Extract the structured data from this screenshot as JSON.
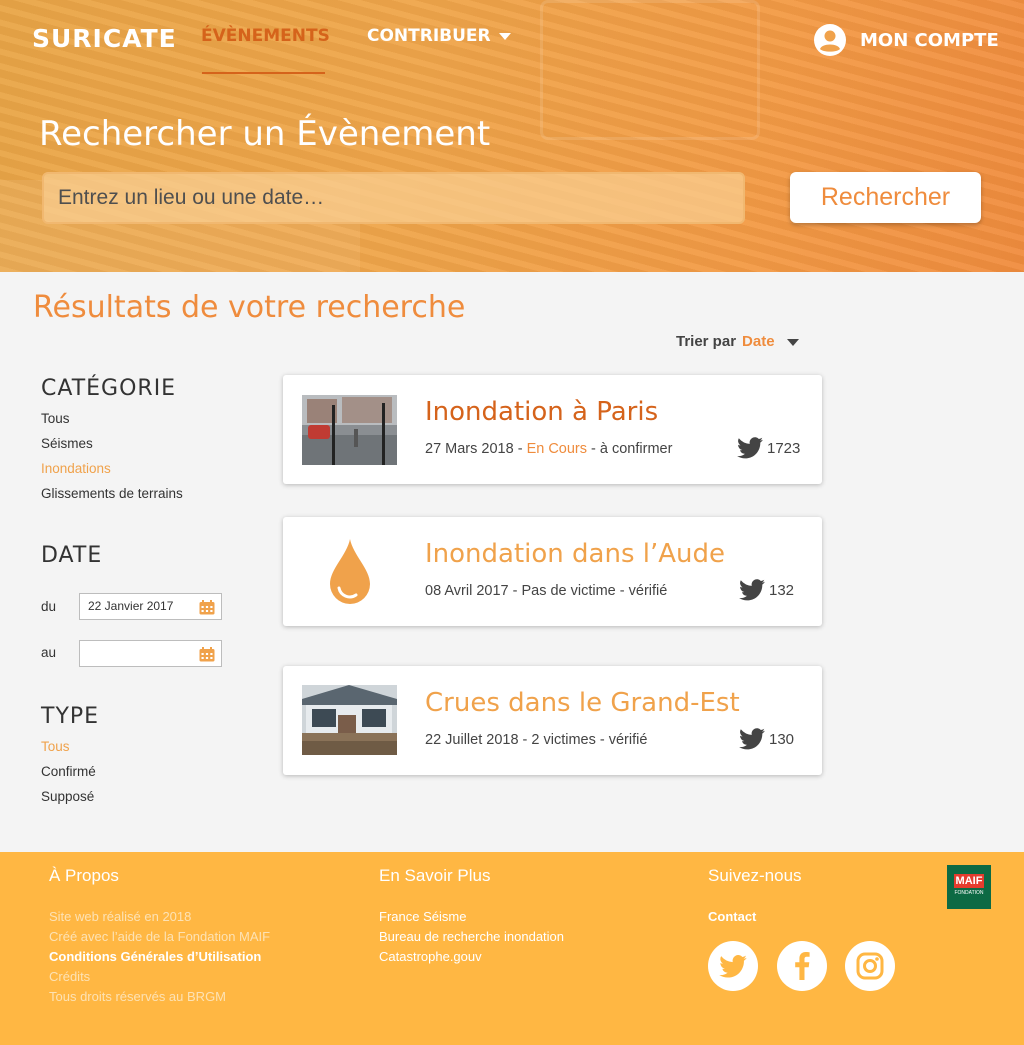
{
  "header": {
    "logo": "SURICATE",
    "nav": [
      {
        "label": "ÉVÈNEMENTS"
      },
      {
        "label": "CONTRIBUER"
      }
    ],
    "account_label": "MON COMPTE"
  },
  "search": {
    "title": "Rechercher un Évènement",
    "placeholder": "Entrez un lieu ou une date…",
    "button": "Rechercher"
  },
  "results": {
    "title": "Résultats de votre recherche",
    "sort_label": "Trier par",
    "sort_value": "Date"
  },
  "filters": {
    "category": {
      "heading": "CATÉGORIE",
      "items": [
        "Tous",
        "Séismes",
        "Inondations",
        "Glissements de terrains"
      ],
      "active_index": 2
    },
    "date": {
      "heading": "DATE",
      "from_label": "du",
      "from_value": "22 Janvier 2017",
      "to_label": "au",
      "to_value": ""
    },
    "type": {
      "heading": "TYPE",
      "items": [
        "Tous",
        "Confirmé",
        "Supposé"
      ],
      "active_index": 0
    }
  },
  "events": [
    {
      "title": "Inondation à Paris",
      "date": "27 Mars 2018 - ",
      "status": "En Cours",
      "suffix": " - à confirmer",
      "tweets": "1723",
      "title_color": "#d5631b",
      "thumb": "photo-rain-street"
    },
    {
      "title": "Inondation dans l’Aude",
      "date": "08 Avril 2017 - Pas de victime - vérifié",
      "status": "",
      "suffix": "",
      "tweets": "132",
      "title_color": "#f0a24b",
      "thumb": "water-drop-icon"
    },
    {
      "title": "Crues dans le Grand-Est",
      "date": "22 Juillet 2018 - 2 victimes - vérifié",
      "status": "",
      "suffix": "",
      "tweets": "130",
      "title_color": "#f0a24b",
      "thumb": "photo-flooded-house"
    }
  ],
  "footer": {
    "about": {
      "heading": "À Propos",
      "lines": [
        "Site web réalisé en 2018",
        "Créé avec l’aide de la Fondation MAIF",
        "Conditions Générales d’Utilisation",
        "Crédits",
        "Tous droits réservés au BRGM"
      ]
    },
    "more": {
      "heading": "En Savoir Plus",
      "links": [
        "France Séisme",
        "Bureau de recherche inondation",
        "Catastrophe.gouv"
      ]
    },
    "follow": {
      "heading": "Suivez-nous",
      "contact": "Contact"
    },
    "maif_logo": "MAIF",
    "maif_sub": "FONDATION"
  },
  "colors": {
    "accent": "#ef8c3d",
    "dark_accent": "#d5631b",
    "footer": "#ffb743"
  }
}
